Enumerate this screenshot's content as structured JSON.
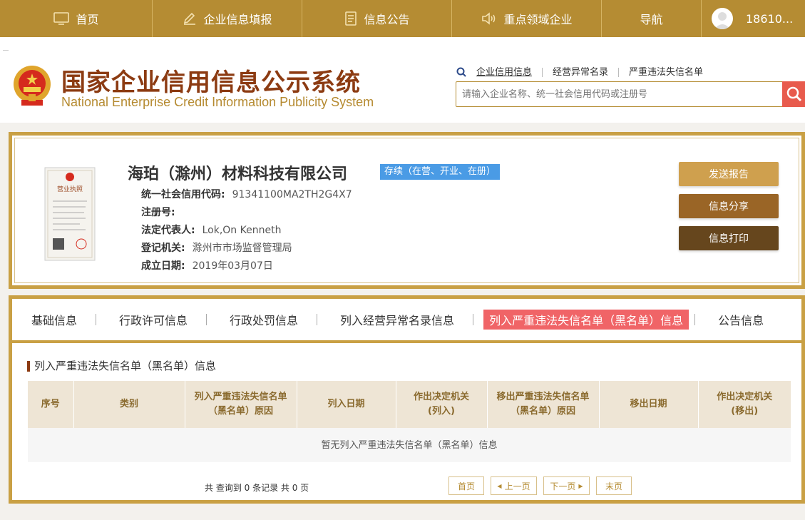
{
  "topnav": {
    "items": [
      {
        "label": "首页",
        "icon": "monitor-icon"
      },
      {
        "label": "企业信息填报",
        "icon": "edit-icon"
      },
      {
        "label": "信息公告",
        "icon": "document-icon"
      },
      {
        "label": "重点领域企业",
        "icon": "speaker-icon"
      },
      {
        "label": "导航",
        "icon": ""
      }
    ],
    "user": "18610..."
  },
  "header": {
    "title": "国家企业信用信息公示系统",
    "subtitle": "National Enterprise Credit Information Publicity System",
    "search_links": [
      "企业信用信息",
      "经营异常名录",
      "严重违法失信名单"
    ],
    "search_placeholder": "请输入企业名称、统一社会信用代码或注册号"
  },
  "company": {
    "name": "海珀（滁州）材料科技有限公司",
    "status": "存续（在营、开业、在册）",
    "credit_code_label": "统一社会信用代码:",
    "credit_code": "91341100MA2TH2G4X7",
    "reg_no_label": "注册号:",
    "reg_no": "",
    "legal_rep_label": "法定代表人:",
    "legal_rep": "Lok,On Kenneth",
    "authority_label": "登记机关:",
    "authority": "滁州市市场监督管理局",
    "founded_label": "成立日期:",
    "founded": "2019年03月07日",
    "license_title": "营业执照",
    "buttons": {
      "send": "发送报告",
      "share": "信息分享",
      "print": "信息打印"
    }
  },
  "tabs": [
    "基础信息",
    "行政许可信息",
    "行政处罚信息",
    "列入经营异常名录信息",
    "列入严重违法失信名单（黑名单）信息",
    "公告信息"
  ],
  "section": {
    "title": "列入严重违法失信名单（黑名单）信息",
    "headers": [
      "序号",
      "类别",
      "列入严重违法失信名单（黑名单）原因",
      "列入日期",
      "作出决定机关(列入)",
      "移出严重违法失信名单（黑名单）原因",
      "移出日期",
      "作出决定机关(移出)"
    ],
    "empty": "暂无列入严重违法失信名单（黑名单）信息",
    "summary": "共 查询到 0 条记录 共 0 页",
    "pager": {
      "first": "首页",
      "prev": "上一页",
      "next": "下一页",
      "last": "末页"
    }
  },
  "colors": {
    "gold": "#b58c33",
    "border": "#c9a044",
    "active_tab": "#f06467",
    "badge": "#4a9be5",
    "btn_send": "#cfa04e",
    "btn_share": "#9a6526",
    "btn_print": "#66461d"
  }
}
